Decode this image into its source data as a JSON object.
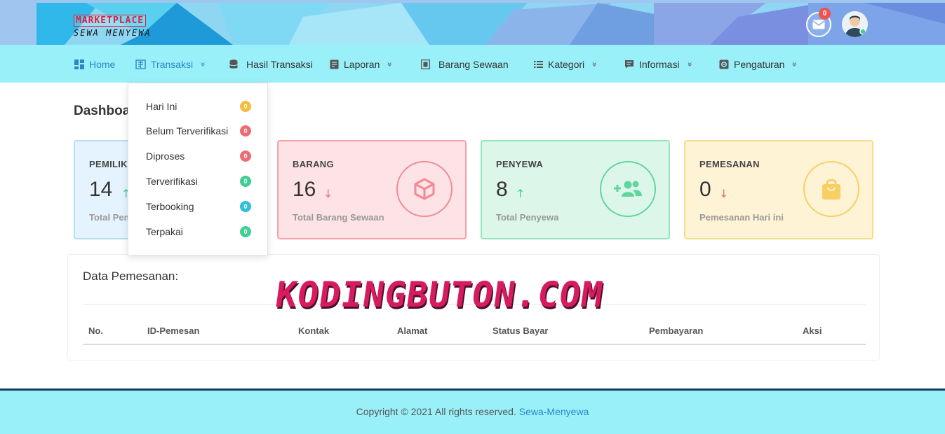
{
  "header": {
    "brand_top": "MARKETPLACE",
    "brand_bottom": "SEWA MENYEWA",
    "mail_badge": "0",
    "colors": {
      "banner": "#9fc6ef",
      "badge": "#ef5350"
    }
  },
  "nav": {
    "items": [
      {
        "label": "Home",
        "icon": "dashboard-icon",
        "active": true
      },
      {
        "label": "Transaksi",
        "icon": "transaction-icon",
        "has_chevron": true
      },
      {
        "label": "Hasil Transaksi",
        "icon": "database-icon"
      },
      {
        "label": "Laporan",
        "icon": "report-icon",
        "has_chevron": true
      },
      {
        "label": "Barang Sewaan",
        "icon": "box-icon"
      },
      {
        "label": "Kategori",
        "icon": "list-icon",
        "has_chevron": true
      },
      {
        "label": "Informasi",
        "icon": "info-icon",
        "has_chevron": true
      },
      {
        "label": "Pengaturan",
        "icon": "settings-icon",
        "has_chevron": true
      }
    ],
    "chevron": "»",
    "colors": {
      "bar": "#9af0f9",
      "active": "#2a87c9"
    }
  },
  "dropdown": {
    "items": [
      {
        "label": "Hari Ini",
        "count": "0",
        "color": "#f5bd3e"
      },
      {
        "label": "Belum Terverifikasi",
        "count": "0",
        "color": "#ef6b73"
      },
      {
        "label": "Diproses",
        "count": "0",
        "color": "#ef6b73"
      },
      {
        "label": "Terverifikasi",
        "count": "0",
        "color": "#3fcf94"
      },
      {
        "label": "Terbooking",
        "count": "0",
        "color": "#2fc0d9"
      },
      {
        "label": "Terpakai",
        "count": "0",
        "color": "#3fcf94"
      }
    ]
  },
  "dashboard": {
    "title": "Dashboard",
    "cards": [
      {
        "title": "PEMILIK",
        "value": "14",
        "trend": "↑",
        "subtitle": "Total Pemilik",
        "icon": "user-icon",
        "bg": "#e5f3ff",
        "border": "#b5dcf6",
        "accent": "#6fc0ee",
        "trend_color": "#3fcf94"
      },
      {
        "title": "BARANG",
        "value": "16",
        "trend": "↓",
        "subtitle": "Total Barang Sewaan",
        "icon": "cube-icon",
        "bg": "#fde3e5",
        "border": "#f3a0a8",
        "accent": "#f08a94",
        "trend_color": "#ef6b73"
      },
      {
        "title": "PENYEWA",
        "value": "8",
        "trend": "↑",
        "subtitle": "Total Penyewa",
        "icon": "user-plus-icon",
        "bg": "#dcf7ea",
        "border": "#96e3bf",
        "accent": "#5fd69d",
        "trend_color": "#3fcf94"
      },
      {
        "title": "PEMESANAN",
        "value": "0",
        "trend": "↓",
        "subtitle": "Pemesanan Hari ini",
        "icon": "shopping-bag-icon",
        "bg": "#fff3d6",
        "border": "#f9dc8a",
        "accent": "#f7cf63",
        "trend_color": "#ef6b73"
      }
    ]
  },
  "orders": {
    "title": "Data Pemesanan:",
    "columns": [
      "No.",
      "ID-Pemesan",
      "Kontak",
      "Alamat",
      "Status Bayar",
      "Pembayaran",
      "Aksi"
    ]
  },
  "watermark": "KODINGBUTON.COM",
  "footer": {
    "text": "Copyright © 2021 All rights reserved.",
    "link": "Sewa-Menyewa"
  }
}
